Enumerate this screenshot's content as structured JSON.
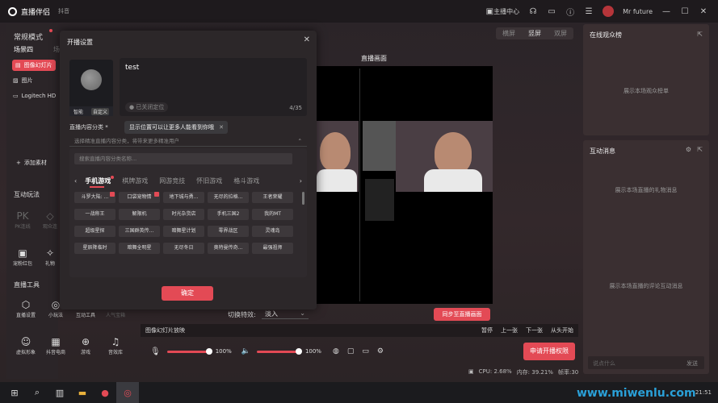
{
  "titlebar": {
    "app_name": "直播伴侣",
    "platform": "抖音",
    "creator_center": "主播中心",
    "username": "Mr future"
  },
  "left": {
    "mode": "常规模式",
    "scene": "场景四",
    "scene_next": "场",
    "sources": [
      {
        "label": "图像幻灯片",
        "active": true
      },
      {
        "label": "图片",
        "active": false
      },
      {
        "label": "Logitech HD",
        "active": false
      }
    ],
    "add_material": "添加素材",
    "interact_title": "互动玩法",
    "interact_tools": [
      {
        "label": "PK连线",
        "glyph": "PK",
        "dim": true
      },
      {
        "label": "观众连",
        "glyph": "◇",
        "dim": true
      },
      {
        "label": "宠粉红包",
        "glyph": "▣",
        "dim": false
      },
      {
        "label": "礼物",
        "glyph": "✧",
        "dim": false
      }
    ],
    "live_tools_title": "直播工具",
    "live_tools": [
      {
        "label": "直播设置",
        "glyph": "⬡",
        "dim": false
      },
      {
        "label": "小玩法",
        "glyph": "◎",
        "dim": false
      },
      {
        "label": "互动工具",
        "glyph": "▤",
        "dim": false
      },
      {
        "label": "人气宝箱",
        "glyph": "",
        "dim": true
      },
      {
        "label": "虚拟形象",
        "glyph": "☺",
        "dim": false
      },
      {
        "label": "抖音电商",
        "glyph": "▦",
        "dim": false
      },
      {
        "label": "游戏",
        "glyph": "⊕",
        "dim": false
      },
      {
        "label": "音效库",
        "glyph": "♫",
        "dim": false
      }
    ]
  },
  "center": {
    "view_tabs": [
      {
        "label": "横屏",
        "on": false
      },
      {
        "label": "竖屏",
        "on": true
      },
      {
        "label": "双屏",
        "on": false
      }
    ],
    "stage_title": "直播画面",
    "transition_label": "切换特效:",
    "transition_value": "淡入",
    "sync_button": "同步至直播画面",
    "slideshow_label": "图像幻灯片放映",
    "slideshow_controls": [
      "暂停",
      "上一张",
      "下一张",
      "从头开始"
    ],
    "mic_volume": "100%",
    "speaker_volume": "100%",
    "apply_button": "申请开播权限",
    "status": {
      "cpu": "CPU: 2.68%",
      "mem": "内存: 39.21%",
      "fps": "帧率:30"
    }
  },
  "right": {
    "audience_title": "在线观众榜",
    "audience_hint": "展示本场观众榜单",
    "messages_title": "互动消息",
    "gift_hint": "展示本场直播的礼物消息",
    "comment_hint": "展示本场直播的评论互动消息",
    "input_placeholder": "说点什么",
    "send_label": "发送"
  },
  "modal": {
    "title": "开播设置",
    "cover_tabs": [
      "智能",
      "自定义"
    ],
    "title_value": "test",
    "location_toggle": "已关闭定位",
    "char_count": "4/35",
    "location_tooltip": "显示位置可以让更多人能看到你哦",
    "category_label": "直播内容分类 *",
    "category_placeholder": "选择精准直播内容分类，将带来更多精准用户",
    "search_placeholder": "搜索直播内容分类名称...",
    "tabs": [
      {
        "label": "手机游戏",
        "on": true
      },
      {
        "label": "棋牌游戏",
        "on": false
      },
      {
        "label": "网游竞技",
        "on": false
      },
      {
        "label": "怀旧游戏",
        "on": false
      },
      {
        "label": "格斗游戏",
        "on": false
      }
    ],
    "games": [
      {
        "label": "斗罗大陆: ...",
        "hot": true
      },
      {
        "label": "口袋宠物情",
        "hot": true
      },
      {
        "label": "地下城与勇...",
        "hot": false
      },
      {
        "label": "无尽的拉格...",
        "hot": false
      },
      {
        "label": "王者荣耀",
        "hot": false
      },
      {
        "label": "一战称王",
        "hot": false
      },
      {
        "label": "解限机",
        "hot": false
      },
      {
        "label": "时光杂货店",
        "hot": false
      },
      {
        "label": "手机三国2",
        "hot": false
      },
      {
        "label": "我的MT",
        "hot": false
      },
      {
        "label": "超级星探",
        "hot": false
      },
      {
        "label": "三国群英传...",
        "hot": false
      },
      {
        "label": "暗舞星计划",
        "hot": false
      },
      {
        "label": "零界战区",
        "hot": false
      },
      {
        "label": "灵魂岛",
        "hot": false
      },
      {
        "label": "星辰降临时",
        "hot": false
      },
      {
        "label": "暗舞全明星",
        "hot": false
      },
      {
        "label": "无尽冬日",
        "hot": false
      },
      {
        "label": "奥特曼传奇...",
        "hot": false
      },
      {
        "label": "最强祖师",
        "hot": false
      }
    ],
    "confirm_button": "确定"
  },
  "watermark": "www.miwenlu.com",
  "clock": "21:51",
  "colors": {
    "accent": "#e34a55",
    "bg": "#2a2428",
    "panel": "#3a2f31"
  }
}
